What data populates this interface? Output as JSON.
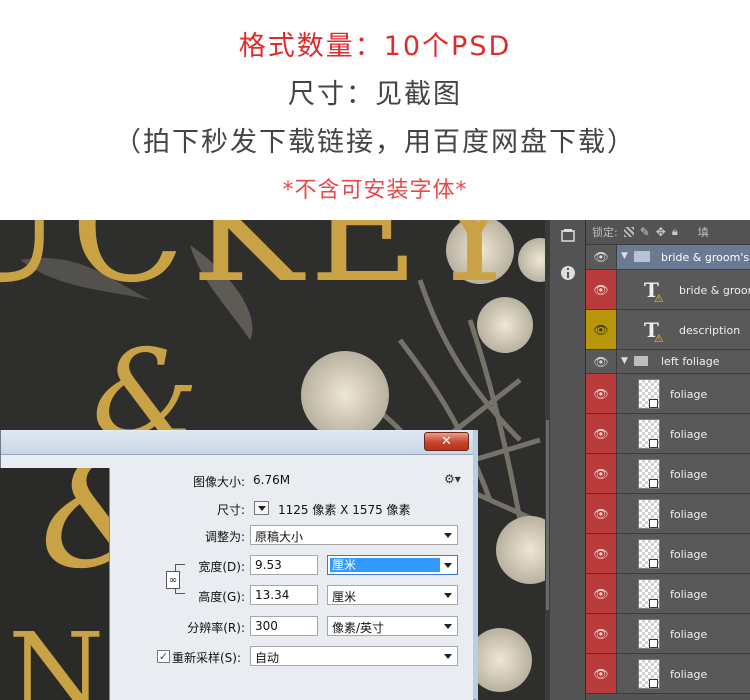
{
  "header": {
    "line1": "格式数量：10个PSD",
    "line2": "尺寸：见截图",
    "line3": "（拍下秒发下载链接，用百度网盘下载）",
    "line4": "*不含可安装字体*",
    "colors": {
      "red": "#e02b2b",
      "dark": "#444444",
      "pink": "#e84a4a"
    }
  },
  "artwork": {
    "title_text": "UCKEY",
    "ampersand": "&",
    "letter": "N",
    "gold": "#c9a245"
  },
  "panel": {
    "lock_label": "锁定:",
    "fill_label": "填",
    "tool_icons": [
      "layer-comps-icon",
      "info-icon"
    ],
    "layers": [
      {
        "name": "bride & groom's n",
        "type": "group",
        "eye": "#535353",
        "expanded": true,
        "selected": true
      },
      {
        "name": "bride & groom",
        "type": "text",
        "eye": "#b83a3a",
        "warning": true
      },
      {
        "name": "description",
        "type": "text",
        "eye": "#b8960c",
        "warning": true
      },
      {
        "name": "left foliage",
        "type": "group",
        "eye": "#535353",
        "expanded": true
      },
      {
        "name": "foliage",
        "type": "smart",
        "eye": "#b83a3a"
      },
      {
        "name": "foliage",
        "type": "smart",
        "eye": "#b83a3a"
      },
      {
        "name": "foliage",
        "type": "smart",
        "eye": "#b83a3a"
      },
      {
        "name": "foliage",
        "type": "smart",
        "eye": "#b83a3a"
      },
      {
        "name": "foliage",
        "type": "smart",
        "eye": "#b83a3a"
      },
      {
        "name": "foliage",
        "type": "smart",
        "eye": "#b83a3a"
      },
      {
        "name": "foliage",
        "type": "smart",
        "eye": "#b83a3a"
      },
      {
        "name": "foliage",
        "type": "smart",
        "eye": "#b83a3a"
      }
    ]
  },
  "dialog": {
    "close_label": "✕",
    "image_size_label": "图像大小:",
    "image_size_value": "6.76M",
    "dimensions_label": "尺寸:",
    "dimensions_value": "1125 像素  X  1575 像素",
    "fit_label": "调整为:",
    "fit_value": "原稿大小",
    "width_label": "宽度(D):",
    "width_value": "9.53",
    "width_unit": "厘米",
    "height_label": "高度(G):",
    "height_value": "13.34",
    "height_unit": "厘米",
    "resolution_label": "分辨率(R):",
    "resolution_value": "300",
    "resolution_unit": "像素/英寸",
    "resample_label": "重新采样(S):",
    "resample_value": "自动",
    "resample_checked": true
  }
}
